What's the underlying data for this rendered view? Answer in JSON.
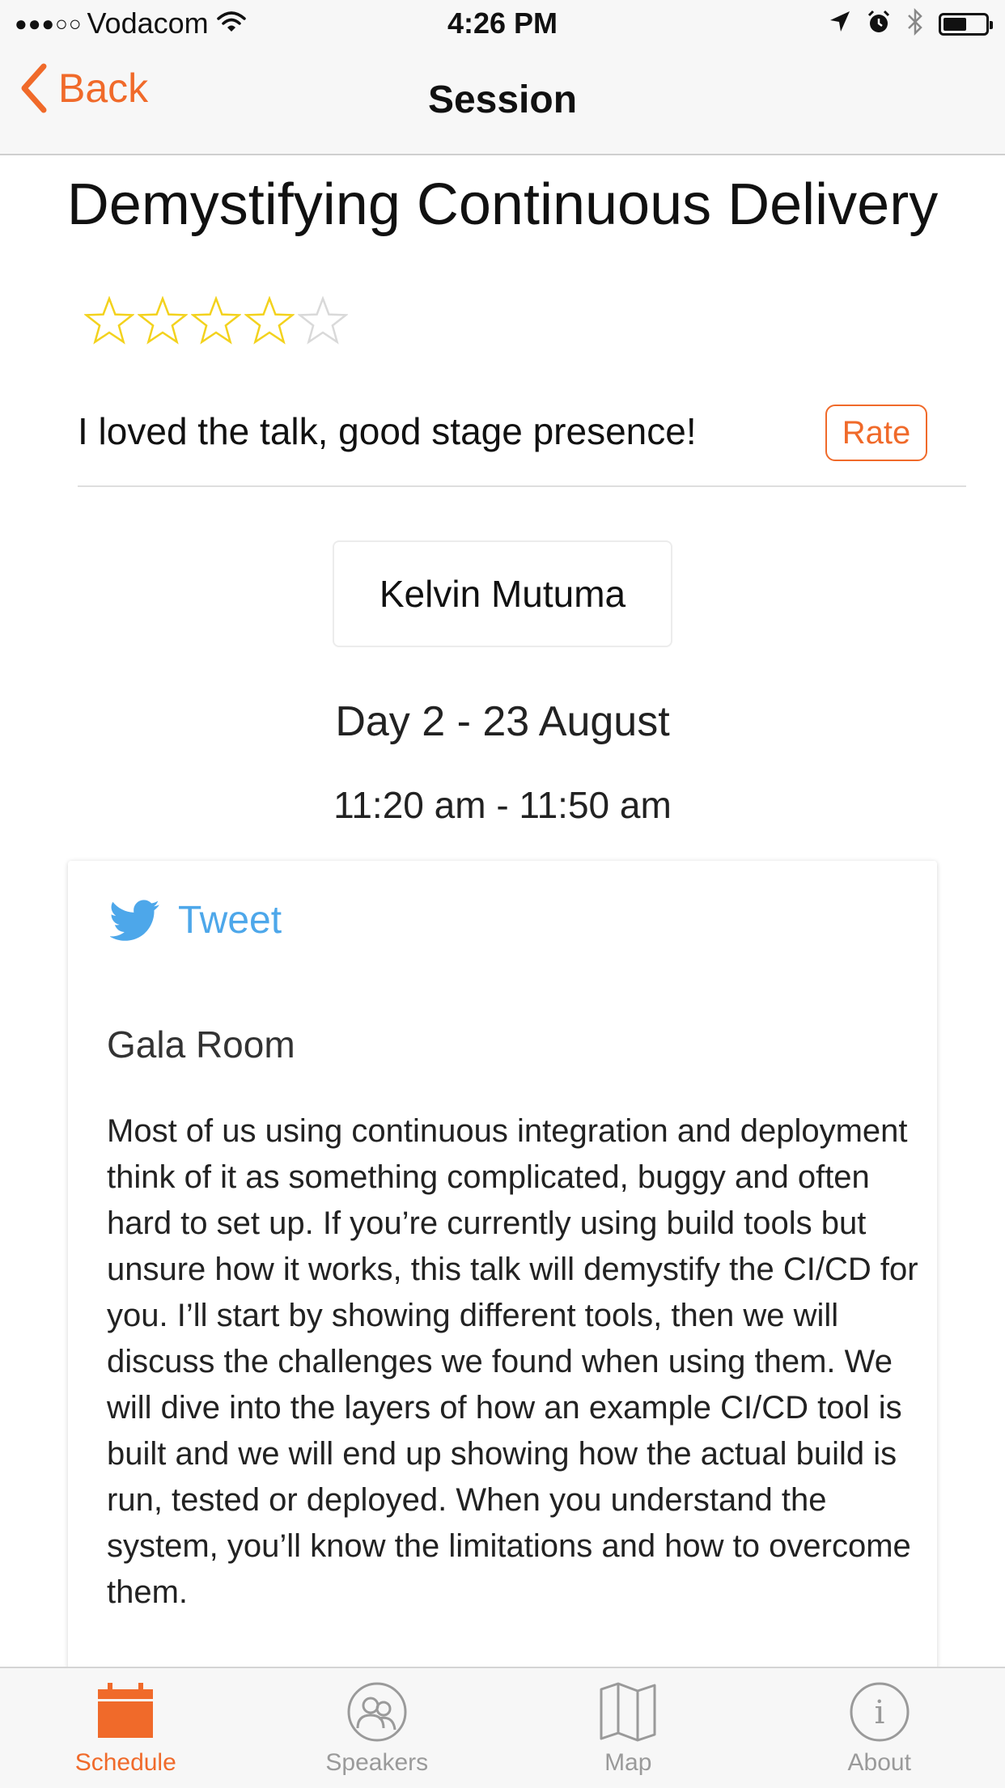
{
  "status_bar": {
    "signal": "●●●○○",
    "carrier": "Vodacom",
    "time": "4:26 PM",
    "battery_level": 0.55
  },
  "nav": {
    "back_label": "Back",
    "title": "Session"
  },
  "session": {
    "title": "Demystifying Continuous Delivery",
    "rating": 4,
    "rating_max": 5,
    "review": "I loved the talk, good stage presence!",
    "rate_label": "Rate",
    "speaker": "Kelvin Mutuma",
    "day": "Day 2 - 23 August",
    "time": "11:20 am - 11:50 am",
    "tweet_label": "Tweet",
    "room": "Gala Room",
    "abstract": "Most of us using continuous integration and deployment think of it as something complicated, buggy and often hard to set up. If you’re currently using build tools but unsure how it works, this talk will demystify the CI/CD for you. I’ll start by showing different tools, then we will discuss the challenges we found when using them. We will dive into the layers of how an example CI/CD tool is built and we will end up showing how the actual build is run, tested or deployed. When you understand the system, you’ll know the limitations and how to overcome them."
  },
  "tabs": [
    {
      "label": "Schedule",
      "icon": "calendar-icon",
      "active": true
    },
    {
      "label": "Speakers",
      "icon": "people-icon",
      "active": false
    },
    {
      "label": "Map",
      "icon": "map-icon",
      "active": false
    },
    {
      "label": "About",
      "icon": "info-icon",
      "active": false
    }
  ],
  "colors": {
    "accent": "#f06a2a",
    "twitter": "#4da7ea",
    "star_filled": "#f3d21d",
    "star_empty": "#d9d9d9",
    "tab_inactive": "#9a9a9a"
  }
}
